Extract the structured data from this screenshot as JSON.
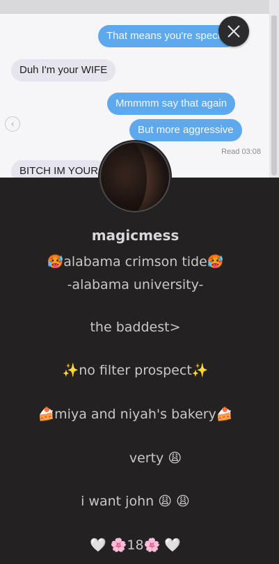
{
  "chat": {
    "messages": [
      {
        "dir": "out",
        "text": "That means you're special"
      },
      {
        "dir": "in",
        "text": "Duh I'm your WIFE"
      },
      {
        "dir": "out",
        "text": "Mmmmm say that again"
      },
      {
        "dir": "out",
        "text": "But more aggressive"
      },
      {
        "dir": "in",
        "text": "BITCH IM YOUR"
      }
    ],
    "read_receipt": "Read 03:08"
  },
  "profile": {
    "username": "magicmess",
    "bio": [
      "🥵alabama crimson tide🥵",
      "-alabama university-",
      "the baddest>",
      "✨no filter prospect✨",
      "🍰miya and niyah's bakery🍰",
      "verty  😩",
      "i want john  😩 😩",
      "🤍 🌸18🌸 🤍"
    ]
  },
  "icons": {
    "close": "close-icon",
    "back": "chevron-left-icon"
  },
  "colors": {
    "background": "#232122",
    "bubble_out": "#5ea9ee",
    "bubble_in": "#e6e4ec",
    "text": "#c9c7c9"
  }
}
